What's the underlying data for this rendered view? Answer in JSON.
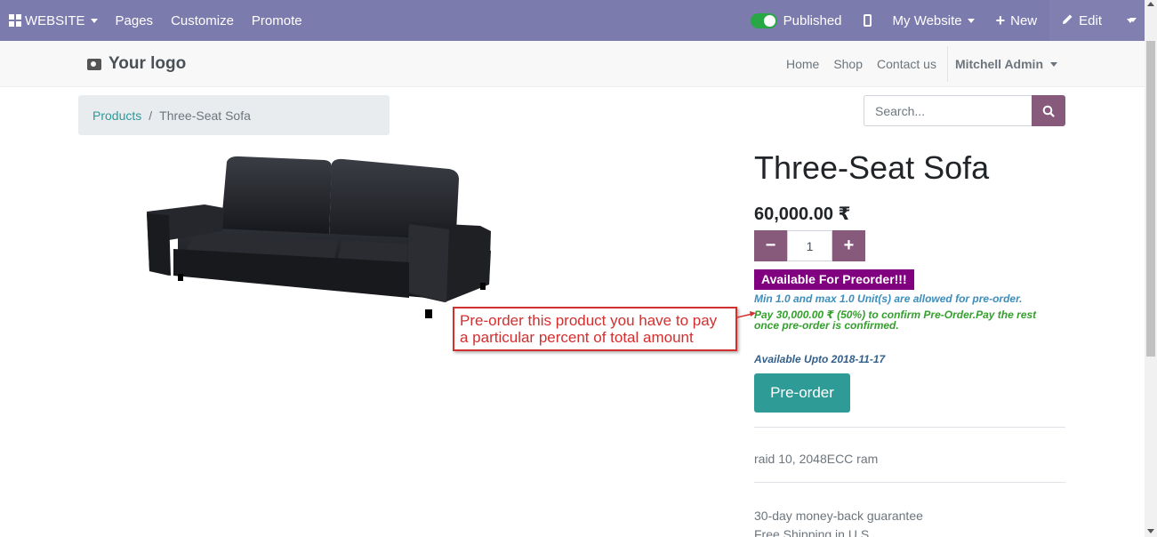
{
  "admin_bar": {
    "website_label": "WEBSITE",
    "pages_label": "Pages",
    "customize_label": "Customize",
    "promote_label": "Promote",
    "published_label": "Published",
    "my_website_label": "My Website",
    "new_label": "New",
    "edit_label": "Edit",
    "bar_color": "#7C7BAD"
  },
  "header": {
    "logo_text": "Your logo",
    "nav": [
      "Home",
      "Shop",
      "Contact us"
    ],
    "user_label": "Mitchell Admin"
  },
  "breadcrumb": {
    "parent": "Products",
    "separator": "/",
    "current": "Three-Seat Sofa"
  },
  "search": {
    "placeholder": "Search..."
  },
  "product": {
    "name": "Three-Seat Sofa",
    "price": "60,000.00 ₹",
    "quantity": "1",
    "minus": "−",
    "plus": "+",
    "badge": "Available For Preorder!!!",
    "limit_note": "Min 1.0 and max 1.0 Unit(s) are allowed for pre-order.",
    "payment_note": "Pay 30,000.00 ₹ (50%) to confirm Pre-Order.Pay the rest once pre-order is confirmed.",
    "available_upto": "Available Upto 2018-11-17",
    "preorder_button": "Pre-order",
    "description": "raid 10, 2048ECC ram",
    "guarantee_line1": "30-day money-back guarantee",
    "guarantee_line2": "Free Shipping in U.S."
  },
  "callout": {
    "text_line1": "Pre-order this product you have to pay",
    "text_line2": "a particular percent of total amount"
  },
  "colors": {
    "primary": "#875A7B",
    "badge": "#800080",
    "teal": "#2e9b96",
    "callout_red": "#d32f2f"
  }
}
